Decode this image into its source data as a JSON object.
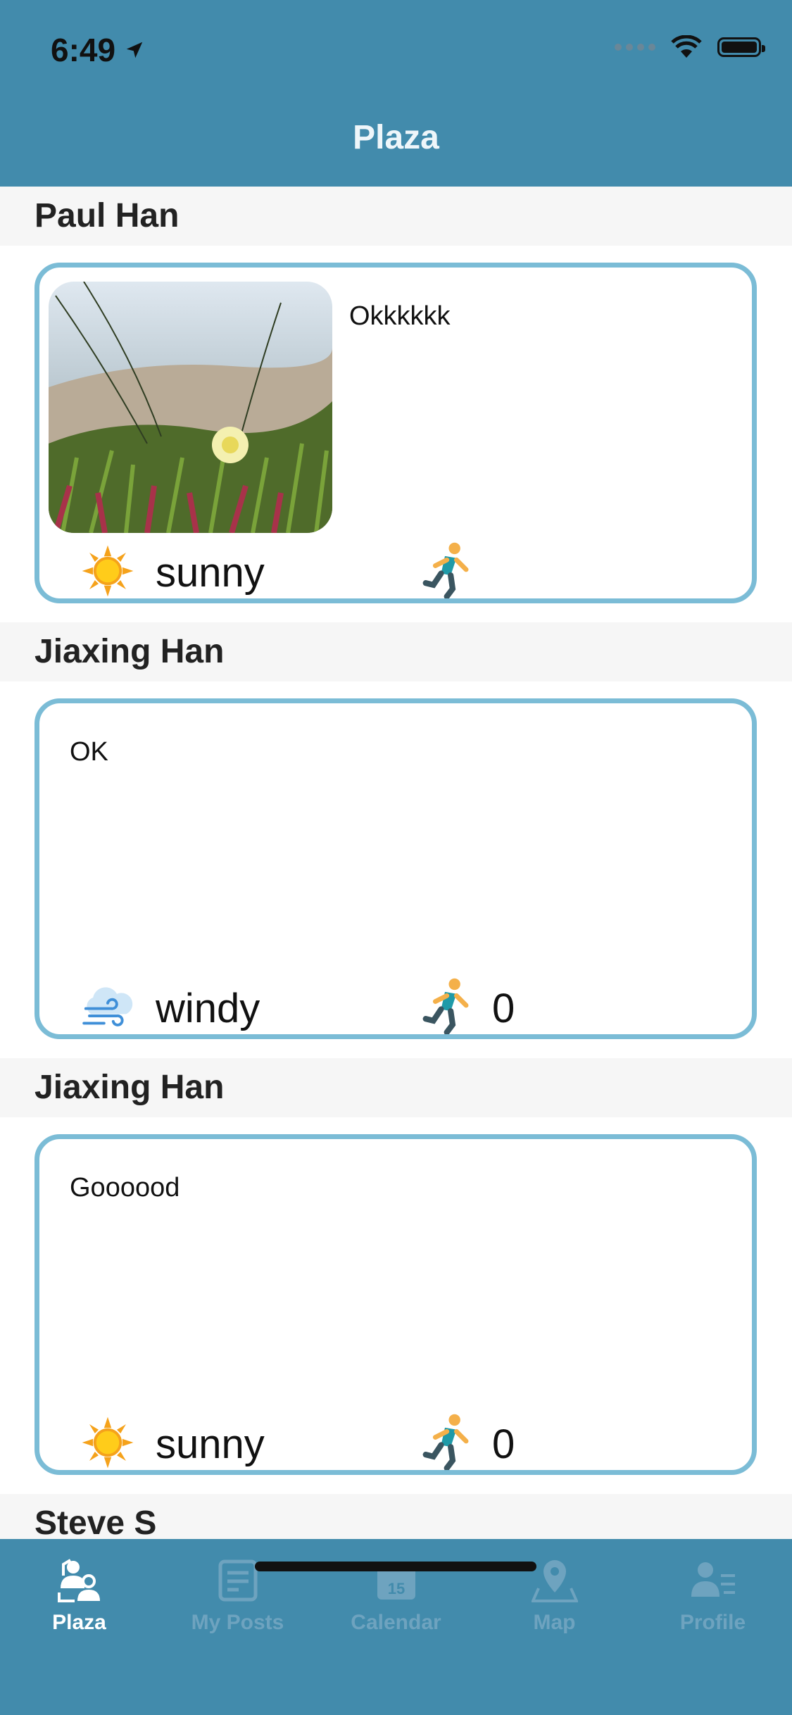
{
  "status_bar": {
    "time": "6:49"
  },
  "nav": {
    "title": "Plaza"
  },
  "posts": [
    {
      "author": "Paul Han",
      "text": "Okkkkkk",
      "weather": "sunny",
      "weather_icon": "sun-icon",
      "activity_icon": "runner-icon",
      "count": ""
    },
    {
      "author": "Jiaxing Han",
      "text": "OK",
      "weather": "windy",
      "weather_icon": "wind-cloud-icon",
      "activity_icon": "runner-icon",
      "count": "0"
    },
    {
      "author": "Jiaxing Han",
      "text": "Goooood",
      "weather": "sunny",
      "weather_icon": "sun-icon",
      "activity_icon": "runner-icon",
      "count": "0"
    },
    {
      "author": "Steve S"
    }
  ],
  "tabs": [
    {
      "label": "Plaza",
      "icon": "plaza-icon",
      "active": true
    },
    {
      "label": "My Posts",
      "icon": "posts-icon",
      "active": false
    },
    {
      "label": "Calendar",
      "icon": "calendar-icon",
      "active": false
    },
    {
      "label": "Map",
      "icon": "map-pin-icon",
      "active": false
    },
    {
      "label": "Profile",
      "icon": "profile-icon",
      "active": false
    }
  ],
  "calendar_icon_day": "15",
  "colors": {
    "header": "#428bac",
    "card_border": "#7bbcd6",
    "tab_active": "#ffffff",
    "tab_inactive": "#6ea3bf"
  }
}
